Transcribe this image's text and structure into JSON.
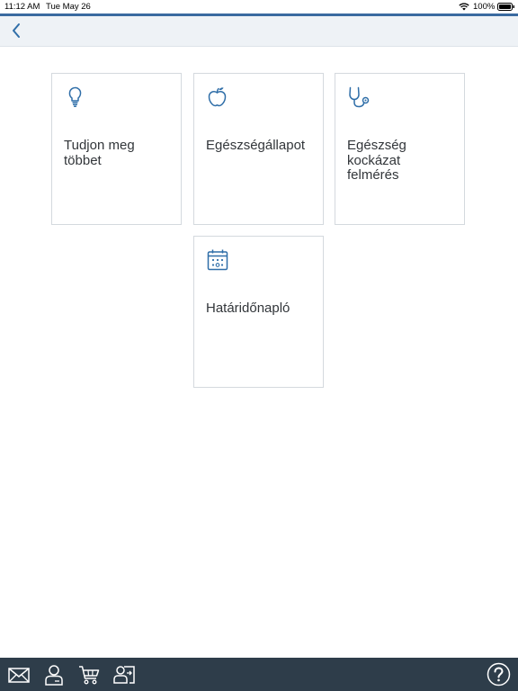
{
  "status_bar": {
    "time": "11:12 AM",
    "date": "Tue May 26",
    "battery": "100%"
  },
  "colors": {
    "accent": "#3a6aa0",
    "icon_blue": "#2f6ea8",
    "tile_border": "#d4d9de",
    "nav_bg": "#eef2f6",
    "bottom_bar_bg": "#2e3d4a",
    "tile_text": "#32363a"
  },
  "nav": {
    "back_icon": "chevron-left-icon"
  },
  "tiles": [
    {
      "icon": "lightbulb-icon",
      "label": "Tudjon meg többet"
    },
    {
      "icon": "apple-icon",
      "label": "Egészségállapot"
    },
    {
      "icon": "stethoscope-icon",
      "label": "Egészség kockázat felmérés"
    },
    {
      "icon": "calendar-icon",
      "label": "Határidőnapló"
    }
  ],
  "bottom_bar": {
    "icons": [
      "mail-icon",
      "user-icon",
      "cart-icon",
      "user-switch-icon",
      "help-icon"
    ]
  }
}
